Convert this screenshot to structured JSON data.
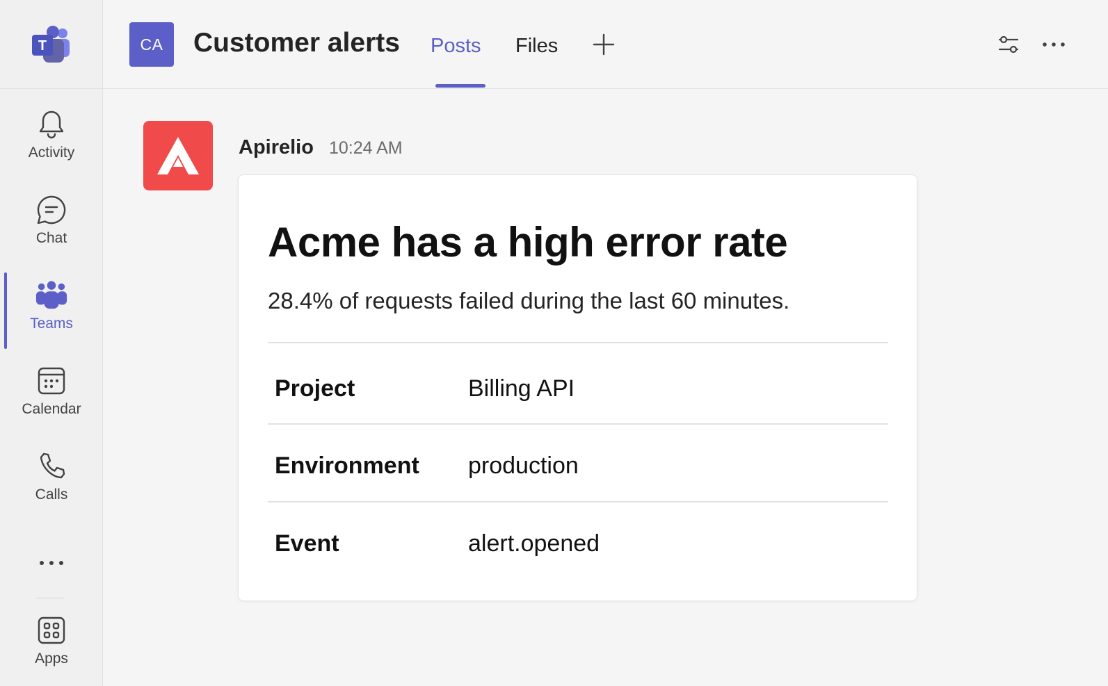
{
  "rail": {
    "items": [
      {
        "label": "Activity",
        "icon": "bell-icon"
      },
      {
        "label": "Chat",
        "icon": "chat-icon"
      },
      {
        "label": "Teams",
        "icon": "teams-icon",
        "active": true
      },
      {
        "label": "Calendar",
        "icon": "calendar-icon"
      },
      {
        "label": "Calls",
        "icon": "phone-icon"
      },
      {
        "label": "Apps",
        "icon": "apps-icon"
      }
    ]
  },
  "header": {
    "team_avatar": "CA",
    "channel_title": "Customer alerts",
    "tabs": [
      {
        "label": "Posts",
        "active": true
      },
      {
        "label": "Files",
        "active": false
      }
    ]
  },
  "message": {
    "sender": "Apirelio",
    "time": "10:24 AM",
    "card": {
      "title": "Acme has a high error rate",
      "description": "28.4% of requests failed during the last 60 minutes.",
      "facts": [
        {
          "key": "Project",
          "value": "Billing API"
        },
        {
          "key": "Environment",
          "value": "production"
        },
        {
          "key": "Event",
          "value": "alert.opened"
        }
      ]
    }
  },
  "colors": {
    "accent": "#5b5fc7",
    "bot_avatar": "#f04a4a",
    "background": "#f5f5f5"
  }
}
